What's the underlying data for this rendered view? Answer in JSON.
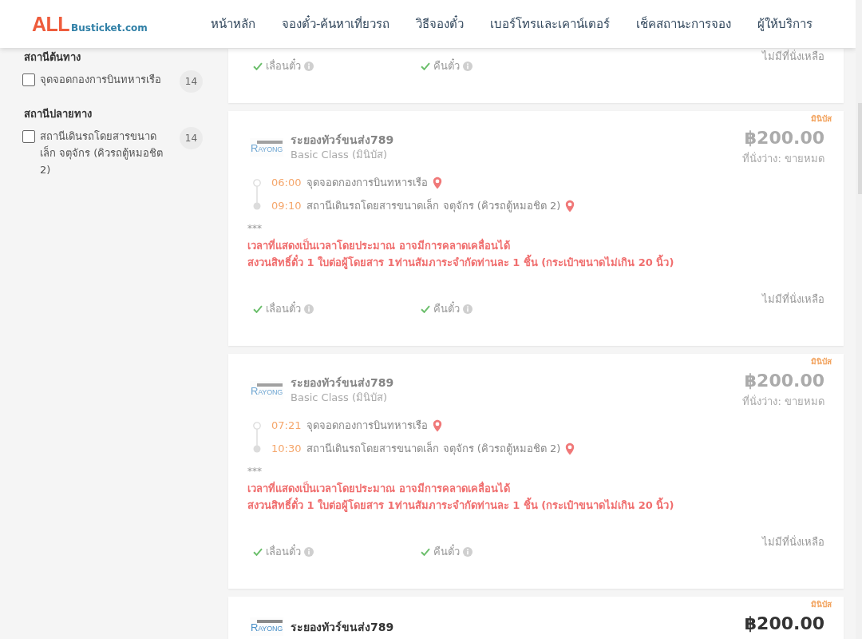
{
  "header": {
    "logo": {
      "primary": "ALL",
      "secondary": "Busticket.com"
    },
    "nav": [
      "หน้าหลัก",
      "จองตั๋ว-ค้นหาเที่ยวรถ",
      "วิธีจองตั๋ว",
      "เบอร์โทรและเคาน์เตอร์",
      "เช็คสถานะการจอง",
      "ผู้ให้บริการ"
    ]
  },
  "filters": [
    {
      "heading": "สถานีต้นทาง",
      "options": [
        {
          "label": "จุดจอดกองการบินทหารเรือ",
          "count": "14",
          "checked": false
        }
      ]
    },
    {
      "heading": "สถานีปลายทาง",
      "options": [
        {
          "label": "สถานีเดินรถโดยสารขนาดเล็ก จตุจักร (คิวรถตู้หมอชิต 2)",
          "count": "14",
          "checked": false
        }
      ]
    }
  ],
  "trips": [
    {
      "features": [
        {
          "label": "เลื่อนตั๋ว",
          "available": true
        },
        {
          "label": "คืนตั๋ว",
          "available": true
        }
      ],
      "seats_note": "ไม่มีที่นั่งเหลือ",
      "sold_out": true
    },
    {
      "tag": "มินิบัส",
      "operator": {
        "logo": "RAYONG",
        "name": "ระยองทัวร์ขนส่ง789",
        "class": "Basic Class (มินิบัส)"
      },
      "price": "฿200.00",
      "availability": "ที่นั่งว่าง: ขายหมด",
      "stops": [
        {
          "time": "06:00",
          "station": "จุดจอดกองการบินทหารเรือ"
        },
        {
          "time": "09:10",
          "station": "สถานีเดินรถโดยสารขนาดเล็ก จตุจักร (คิวรถตู้หมอชิต 2)"
        }
      ],
      "note_mark": "***",
      "notes": [
        "เวลาที่แสดงเป็นเวลาโดยประมาณ อาจมีการคลาดเคลื่อนได้",
        "สงวนสิทธิ์ตั๋ว 1 ใบต่อผู้โดยสาร 1ท่านสัมภาระจำกัดท่านละ 1 ชิ้น (กระเป๋าขนาดไม่เกิน 20 นิ้ว)"
      ],
      "features": [
        {
          "label": "เลื่อนตั๋ว",
          "available": true
        },
        {
          "label": "คืนตั๋ว",
          "available": true
        }
      ],
      "seats_note": "ไม่มีที่นั่งเหลือ",
      "sold_out": true
    },
    {
      "tag": "มินิบัส",
      "operator": {
        "logo": "RAYONG",
        "name": "ระยองทัวร์ขนส่ง789",
        "class": "Basic Class (มินิบัส)"
      },
      "price": "฿200.00",
      "availability": "ที่นั่งว่าง: ขายหมด",
      "stops": [
        {
          "time": "07:21",
          "station": "จุดจอดกองการบินทหารเรือ"
        },
        {
          "time": "10:30",
          "station": "สถานีเดินรถโดยสารขนาดเล็ก จตุจักร (คิวรถตู้หมอชิต 2)"
        }
      ],
      "note_mark": "***",
      "notes": [
        "เวลาที่แสดงเป็นเวลาโดยประมาณ อาจมีการคลาดเคลื่อนได้",
        "สงวนสิทธิ์ตั๋ว 1 ใบต่อผู้โดยสาร 1ท่านสัมภาระจำกัดท่านละ 1 ชิ้น (กระเป๋าขนาดไม่เกิน 20 นิ้ว)"
      ],
      "features": [
        {
          "label": "เลื่อนตั๋ว",
          "available": true
        },
        {
          "label": "คืนตั๋ว",
          "available": true
        }
      ],
      "seats_note": "ไม่มีที่นั่งเหลือ",
      "sold_out": true
    },
    {
      "tag": "มินิบัส",
      "operator": {
        "logo": "RAYONG",
        "name": "ระยองทัวร์ขนส่ง789"
      },
      "price": "฿200.00",
      "sold_out": false
    }
  ]
}
